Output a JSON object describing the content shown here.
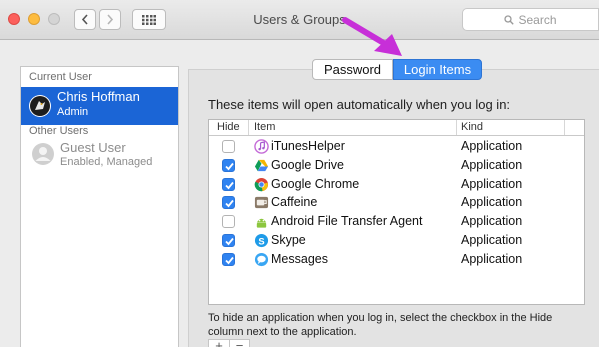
{
  "window": {
    "title": "Users & Groups"
  },
  "toolbar": {
    "search_placeholder": "Search"
  },
  "sidebar": {
    "current_user_header": "Current User",
    "current_user": {
      "name": "Chris Hoffman",
      "role": "Admin"
    },
    "other_users_header": "Other Users",
    "other_users": [
      {
        "name": "Guest User",
        "status": "Enabled, Managed"
      }
    ]
  },
  "tabs": {
    "password": "Password",
    "login_items": "Login Items",
    "selected": "Login Items"
  },
  "main": {
    "intro": "These items will open automatically when you log in:"
  },
  "table": {
    "headers": {
      "hide": "Hide",
      "item": "Item",
      "kind": "Kind"
    },
    "rows": [
      {
        "hide": false,
        "name": "iTunesHelper",
        "kind": "Application",
        "icon": "itunes-icon"
      },
      {
        "hide": true,
        "name": "Google Drive",
        "kind": "Application",
        "icon": "google-drive-icon"
      },
      {
        "hide": true,
        "name": "Google Chrome",
        "kind": "Application",
        "icon": "chrome-icon"
      },
      {
        "hide": true,
        "name": "Caffeine",
        "kind": "Application",
        "icon": "caffeine-icon"
      },
      {
        "hide": false,
        "name": "Android File Transfer Agent",
        "kind": "Application",
        "icon": "android-icon"
      },
      {
        "hide": true,
        "name": "Skype",
        "kind": "Application",
        "icon": "skype-icon"
      },
      {
        "hide": true,
        "name": "Messages",
        "kind": "Application",
        "icon": "messages-icon"
      }
    ]
  },
  "help": {
    "text": "To hide an application when you log in, select the checkbox in the Hide column next to the application."
  },
  "controls": {
    "add_label": "+",
    "remove_label": "−"
  },
  "colors": {
    "accent": "#3b8cf2",
    "selection": "#1b65d6",
    "annotation_arrow": "#c72fd8"
  }
}
